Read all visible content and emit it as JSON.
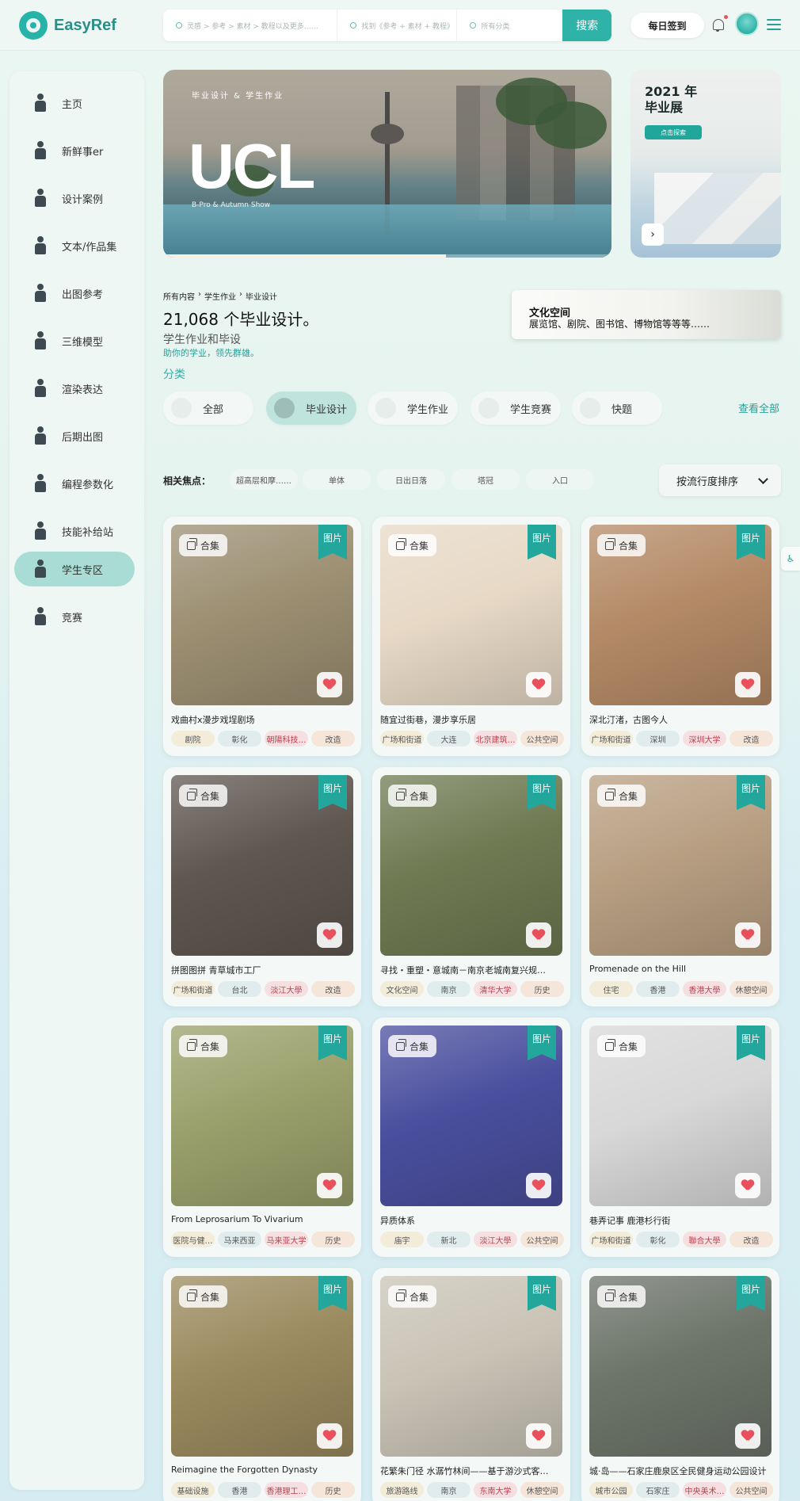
{
  "header": {
    "logo_text": "EasyRef",
    "search_fields": [
      "灵感 > 参考 > 素材 > 教程以及更多……",
      "找到《参考 + 素材 + 教程》",
      "所有分类"
    ],
    "search_button": "搜索",
    "checkin_label": "每日签到"
  },
  "sidebar": {
    "items": [
      {
        "label": "主页",
        "icon": "home-figure-icon"
      },
      {
        "label": "新鲜事er",
        "icon": "news-figure-icon"
      },
      {
        "label": "设计案例",
        "icon": "case-figure-icon"
      },
      {
        "label": "文本/作品集",
        "icon": "portfolio-figure-icon"
      },
      {
        "label": "出图参考",
        "icon": "drawing-figure-icon"
      },
      {
        "label": "三维模型",
        "icon": "model-figure-icon"
      },
      {
        "label": "渲染表达",
        "icon": "render-figure-icon"
      },
      {
        "label": "后期出图",
        "icon": "postproduction-figure-icon"
      },
      {
        "label": "编程参数化",
        "icon": "parametric-figure-icon"
      },
      {
        "label": "技能补给站",
        "icon": "skills-figure-icon"
      },
      {
        "label": "学生专区",
        "icon": "student-figure-icon",
        "active": true
      },
      {
        "label": "竞赛",
        "icon": "competition-figure-icon"
      }
    ]
  },
  "banner": {
    "kicker": "毕业设计 & 学生作业",
    "title": "UCL",
    "subtitle": "B-Pro & Autumn Show",
    "progress": 0.63
  },
  "side_banner": {
    "title": "2021 年\n毕业展",
    "button": "点击探索"
  },
  "category": {
    "breadcrumb": [
      "所有内容",
      "学生作业",
      "毕业设计"
    ],
    "count_title": "21,068 个毕业设计。",
    "subtitle": "学生作业和毕设",
    "note": "助你的学业，领先群雄。",
    "section_label": "分类",
    "tabs": [
      "全部",
      "毕业设计",
      "学生作业",
      "学生竞赛",
      "快题"
    ],
    "active_tab": "毕业设计",
    "view_all": "查看全部"
  },
  "promo": {
    "title": "文化空间",
    "subtitle": "展览馆、剧院、图书馆、博物馆等等等……"
  },
  "focus": {
    "label": "相关焦点：",
    "chips": [
      "超高层和摩……",
      "单体",
      "日出日落",
      "塔冠",
      "入口"
    ],
    "sort": "按流行度排序"
  },
  "cards": [
    {
      "title": "戏曲村x漫步戏埕剧场",
      "badge": "合集",
      "type": "图片",
      "tags": [
        "剧院",
        "彰化",
        "朝陽科技…",
        "改造"
      ],
      "img": "#9c8f72"
    },
    {
      "title": "随宜过街巷，漫步享乐居",
      "badge": "合集",
      "type": "图片",
      "tags": [
        "广场和街道",
        "大连",
        "北京建筑…",
        "公共空间"
      ],
      "img": "#e7d9c6"
    },
    {
      "title": "深北汀渚，古图今人",
      "badge": "合集",
      "type": "图片",
      "tags": [
        "广场和街道",
        "深圳",
        "深圳大学",
        "改造"
      ],
      "img": "#b48a66"
    },
    {
      "title": "拼图图拼 青草城市工厂",
      "badge": "合集",
      "type": "图片",
      "tags": [
        "广场和街道",
        "台北",
        "淡江大學",
        "改造"
      ],
      "img": "#5f5650"
    },
    {
      "title": "寻找・重塑・意城南－南京老城南复兴规…",
      "badge": "合集",
      "type": "图片",
      "tags": [
        "文化空间",
        "南京",
        "清华大学",
        "历史"
      ],
      "img": "#6f7a52"
    },
    {
      "title": "Promenade on the Hill",
      "badge": "合集",
      "type": "图片",
      "tags": [
        "住宅",
        "香港",
        "香港大學",
        "休憩空间"
      ],
      "img": "#b89f82"
    },
    {
      "title": "From Leprosarium To Vivarium",
      "badge": "合集",
      "type": "图片",
      "tags": [
        "医院与健…",
        "马来西亚",
        "马来亚大学",
        "历史"
      ],
      "img": "#9aa06b"
    },
    {
      "title": "异质体系",
      "badge": "合集",
      "type": "图片",
      "tags": [
        "庙宇",
        "新北",
        "淡江大學",
        "公共空间"
      ],
      "img": "#4a4f9e"
    },
    {
      "title": "巷弄记事 鹿港杉行街",
      "badge": "合集",
      "type": "图片",
      "tags": [
        "广场和街道",
        "彰化",
        "聯合大學",
        "改造"
      ],
      "img": "#d8d8d8"
    },
    {
      "title": "Reimagine the Forgotten Dynasty",
      "badge": "合集",
      "type": "图片",
      "tags": [
        "基础设施",
        "香港",
        "香港理工…",
        "历史"
      ],
      "img": "#9a8a5e"
    },
    {
      "title": "花繁朱门径 水潺竹林间——基于游沙式客…",
      "badge": "合集",
      "type": "图片",
      "tags": [
        "旅游路线",
        "南京",
        "东南大学",
        "休憩空间"
      ],
      "img": "#c9c4b6"
    },
    {
      "title": "城·岛——石家庄鹿泉区全民健身运动公园设计",
      "badge": "合集",
      "type": "图片",
      "tags": [
        "城市公园",
        "石家庄",
        "中央美术…",
        "公共空间"
      ],
      "img": "#6d7469"
    }
  ]
}
